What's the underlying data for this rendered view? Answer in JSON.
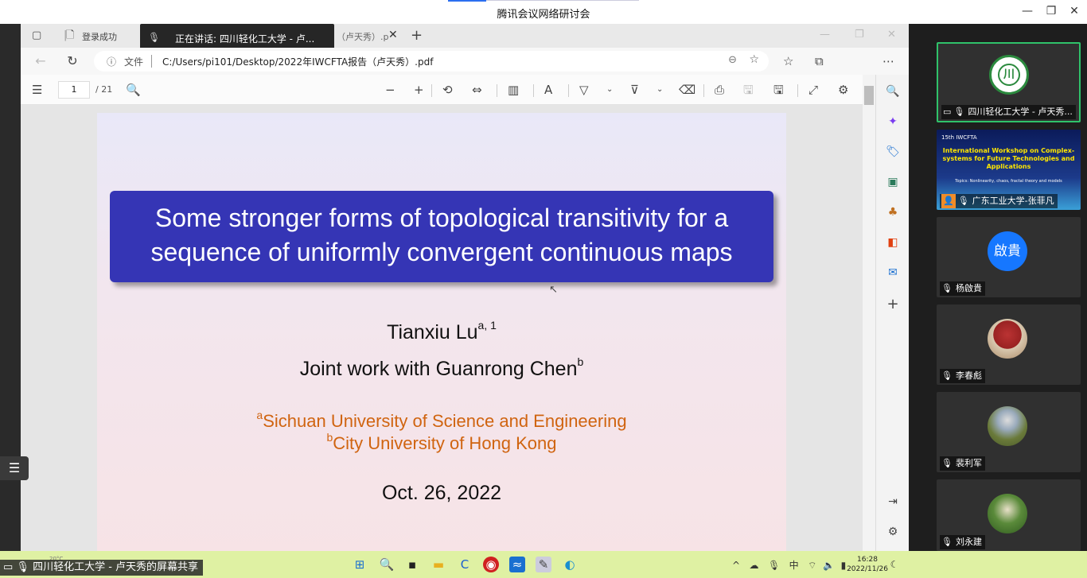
{
  "window": {
    "title": "腾讯会议网络研讨会",
    "minimize": "—",
    "restore": "❐",
    "close": "✕"
  },
  "browser": {
    "tabs": [
      {
        "label": "登录成功"
      },
      {
        "label": "正在讲话: 四川轻化工大学 - 卢..."
      },
      {
        "label": "（卢天秀）.p"
      }
    ],
    "new_tab": "+",
    "address": {
      "info_label": "文件",
      "url": "C:/Users/pi101/Desktop/2022年IWCFTA报告（卢天秀）.pdf"
    }
  },
  "pdf_toolbar": {
    "page_current": "1",
    "page_total": "/ 21"
  },
  "slide": {
    "title_line1": "Some stronger forms of topological transitivity for a",
    "title_line2": "sequence of uniformly convergent continuous maps",
    "author_name": "Tianxiu Lu",
    "author_sup": "a, 1",
    "joint": "Joint work with Guanrong Chen",
    "joint_sup": "b",
    "aff1_sup": "a",
    "aff1": "Sichuan University of Science and Engineering",
    "aff2_sup": "b",
    "aff2": "City University of Hong Kong",
    "date": "Oct. 26, 2022"
  },
  "participants": [
    {
      "name": "四川轻化工大学 - 卢天秀...",
      "kind": "logo",
      "logo_text": "川"
    },
    {
      "name": "广东工业大学-张菲凡",
      "kind": "poster",
      "poster_header": "15th IWCFTA",
      "poster_title": "International Workshop on Complex-systems for Future Technologies and Applications",
      "poster_sub": "Topics: Nonlinearity, chaos, fractal theory and models"
    },
    {
      "name": "杨啟貴",
      "kind": "initials",
      "initials": "啟貴"
    },
    {
      "name": "李春彪",
      "kind": "photo"
    },
    {
      "name": "裴利军",
      "kind": "photo"
    },
    {
      "name": "刘永建",
      "kind": "photo"
    }
  ],
  "taskbar": {
    "sharing": "四川轻化工大学 - 卢天秀的屏幕共享",
    "temp": "20°C",
    "ime": "中",
    "time": "16:28",
    "date": "2022/11/26"
  },
  "colors": {
    "slide_title_bg": "#3535b5",
    "affiliation": "#d06410",
    "taskbar": "#dff1a3",
    "active_tile": "#2fc26a"
  }
}
